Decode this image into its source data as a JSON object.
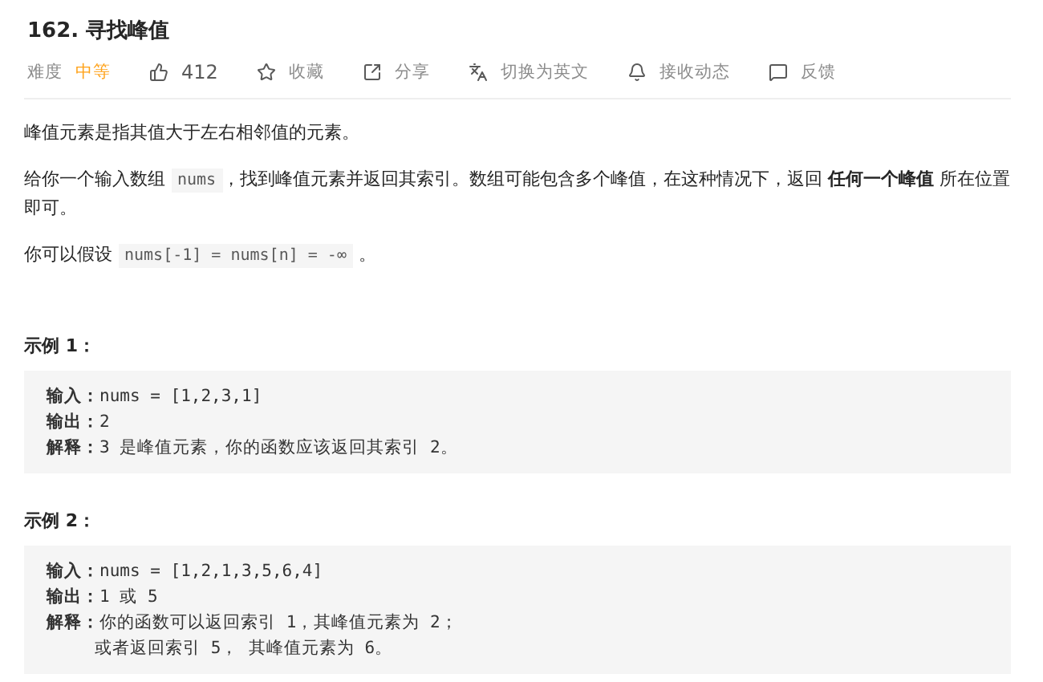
{
  "title": "162. 寻找峰值",
  "meta": {
    "difficulty_label": "难度",
    "difficulty": "中等",
    "actions": [
      {
        "kind": "like",
        "label": "412"
      },
      {
        "kind": "star",
        "label": "收藏"
      },
      {
        "kind": "share",
        "label": "分享"
      },
      {
        "kind": "translate",
        "label": "切换为英文"
      },
      {
        "kind": "bell",
        "label": "接收动态"
      },
      {
        "kind": "feedback",
        "label": "反馈"
      }
    ]
  },
  "description": [
    [
      {
        "kind": "text",
        "text": "峰值元素是指其值大于左右相邻值的元素。"
      }
    ],
    [
      {
        "kind": "text",
        "text": "给你一个输入数组 "
      },
      {
        "kind": "code",
        "text": "nums"
      },
      {
        "kind": "text",
        "text": "，找到峰值元素并返回其索引。数组可能包含多个峰值，在这种情况下，返回 **任何一个峰值** 所在位置即可。"
      }
    ],
    [
      {
        "kind": "text",
        "text": "你可以假设 "
      },
      {
        "kind": "code",
        "text": "nums[-1] = nums[n] = -∞"
      },
      {
        "kind": "text",
        "text": " 。"
      }
    ]
  ],
  "examples": [
    {
      "heading": "示例 1：",
      "lines": [
        {
          "label": "输入：",
          "value": "nums = [1,2,3,1]"
        },
        {
          "label": "输出：",
          "value": "2"
        },
        {
          "label": "解释：",
          "value": "3 是峰值元素，你的函数应该返回其索引 2。"
        }
      ]
    },
    {
      "heading": "示例 2：",
      "lines": [
        {
          "label": "输入：",
          "value": "nums = [1,2,1,3,5,6,4]"
        },
        {
          "label": "输出：",
          "value": "1 或 5"
        },
        {
          "label": "解释：",
          "value": "你的函数可以返回索引 1，其峰值元素为 2；"
        },
        {
          "value": "或者返回索引 5， 其峰值元素为 6。"
        }
      ]
    }
  ]
}
